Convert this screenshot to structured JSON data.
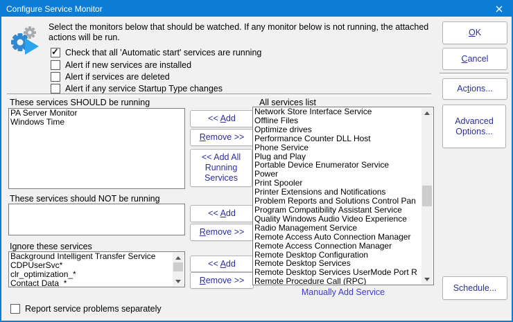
{
  "window": {
    "title": "Configure Service Monitor"
  },
  "header": {
    "instruction": "Select the monitors below that should be watched.  If any monitor below is not running, the attached actions will be run."
  },
  "options": [
    {
      "label": "Check that all 'Automatic start' services are running",
      "checked": true
    },
    {
      "label": "Alert if new services are installed",
      "checked": false
    },
    {
      "label": "Alert if services are deleted",
      "checked": false
    },
    {
      "label": "Alert if any service Startup Type changes",
      "checked": false
    }
  ],
  "should_run": {
    "label": "These services SHOULD be running",
    "items": [
      "PA Server Monitor",
      "Windows Time"
    ]
  },
  "should_not_run": {
    "label": "These services should NOT be running",
    "items": []
  },
  "ignore": {
    "label": "Ignore these services",
    "items": [
      "Background Intelligent Transfer Service",
      "CDPUserSvc*",
      "clr_optimization_*",
      "Contact Data_*"
    ]
  },
  "all_services": {
    "label": "All services list",
    "items": [
      "Network Store Interface Service",
      "Offline Files",
      "Optimize drives",
      "Performance Counter DLL Host",
      "Phone Service",
      "Plug and Play",
      "Portable Device Enumerator Service",
      "Power",
      "Print Spooler",
      "Printer Extensions and Notifications",
      "Problem Reports and Solutions Control Pan",
      "Program Compatibility Assistant Service",
      "Quality Windows Audio Video Experience",
      "Radio Management Service",
      "Remote Access Auto Connection Manager",
      "Remote Access Connection Manager",
      "Remote Desktop Configuration",
      "Remote Desktop Services",
      "Remote Desktop Services UserMode Port R",
      "Remote Procedure Call (RPC)"
    ],
    "link": "Manually Add Service"
  },
  "buttons": {
    "add": {
      "pre": "<< ",
      "u": "A",
      "post": "dd"
    },
    "remove": {
      "u": "R",
      "post": "emove >>"
    },
    "add_all": "<< Add All Running Services",
    "ok": {
      "u": "O",
      "post": "K"
    },
    "cancel": {
      "u": "C",
      "post": "ancel"
    },
    "actions": {
      "pre": "Ac",
      "u": "t",
      "post": "ions..."
    },
    "advanced": "Advanced Options...",
    "schedule": "Schedule..."
  },
  "footer": {
    "report_label": "Report service problems separately",
    "report_checked": false
  },
  "colors": {
    "titlebar": "#0c7dd6",
    "button_text": "#2d2d9c",
    "link": "#3b3bd9"
  }
}
